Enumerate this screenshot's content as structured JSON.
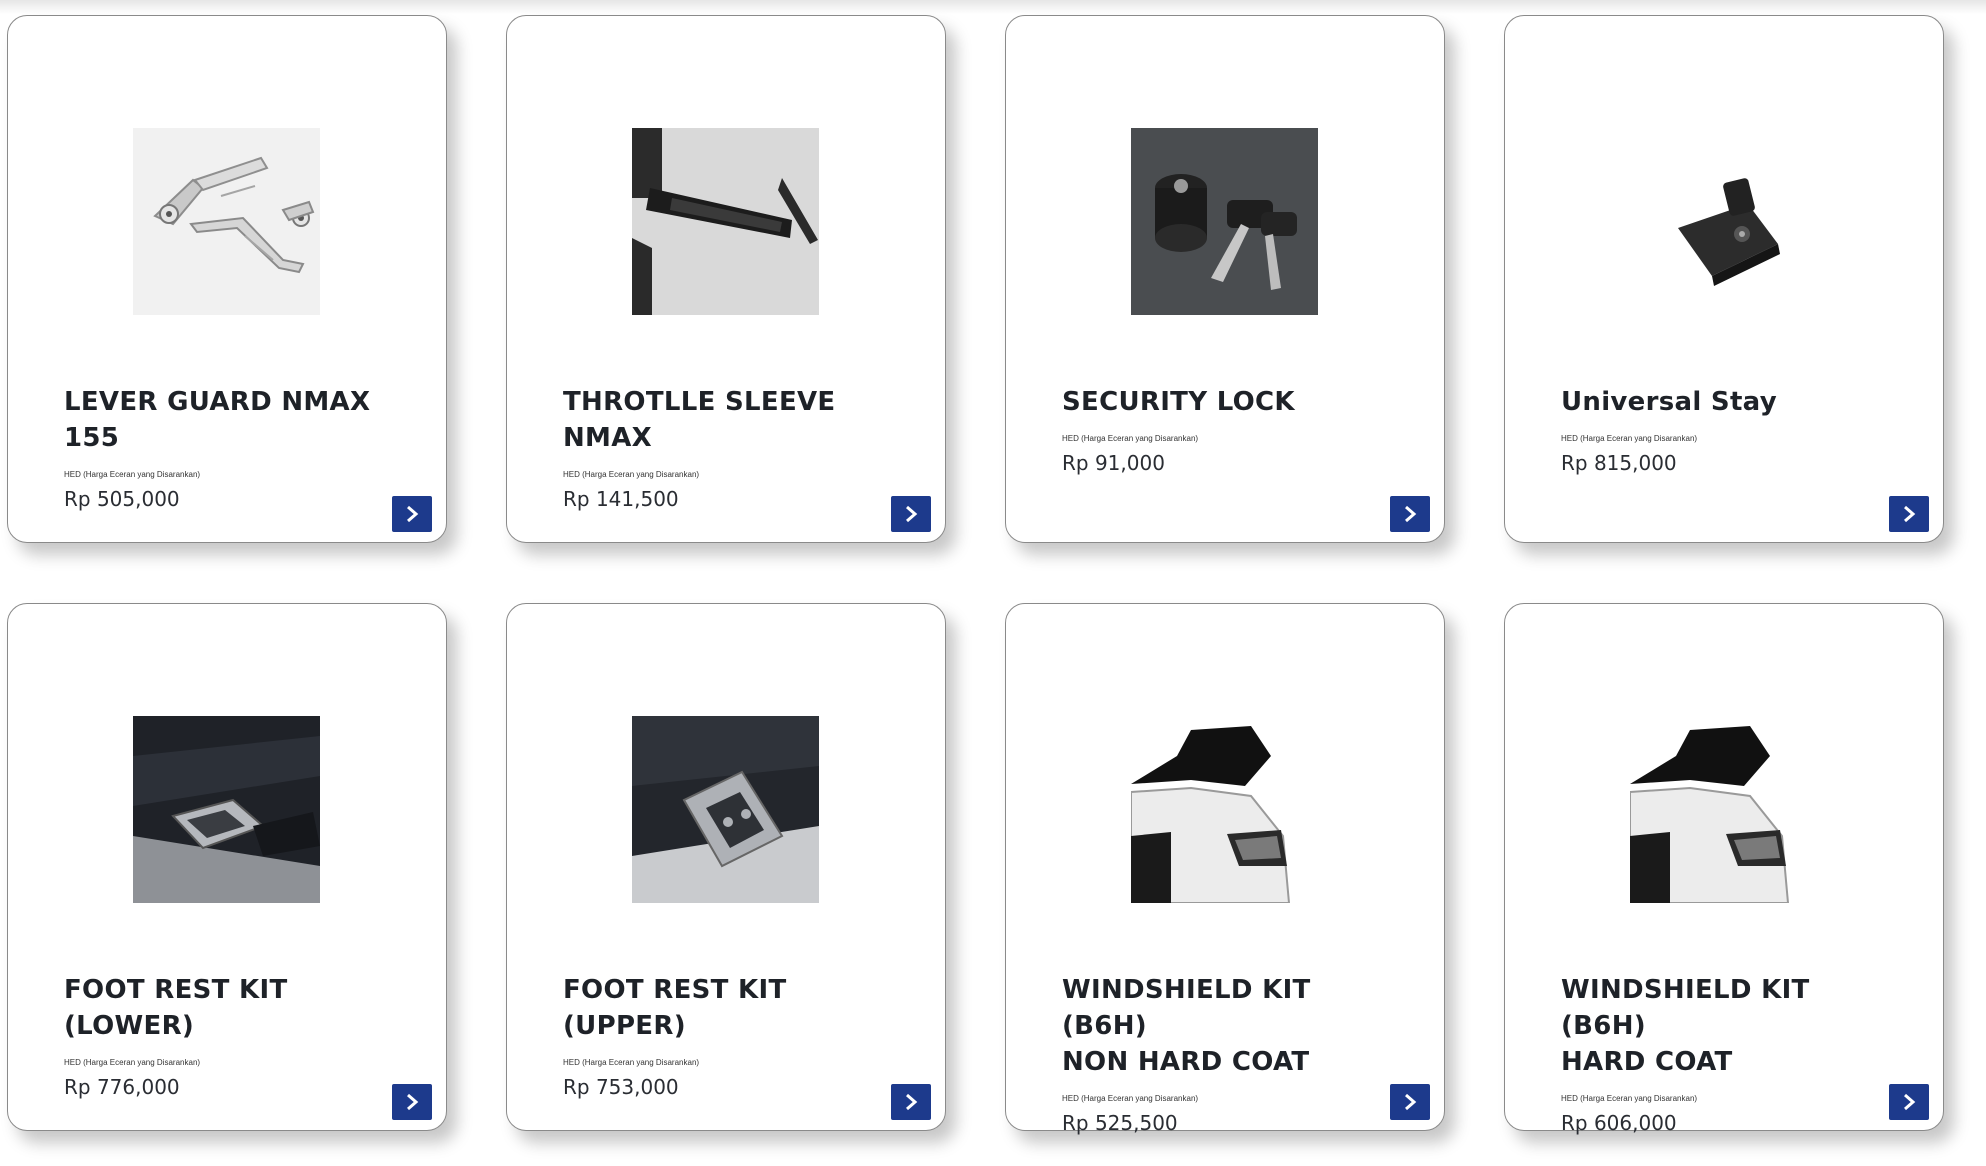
{
  "products": [
    {
      "name_line1": "LEVER GUARD NMAX",
      "name_line2": "155",
      "hed_label": "HED (Harga Eceran yang Disarankan)",
      "price": "Rp 505,000",
      "image_icon": "lever-guard-photo",
      "button_icon": "chevron-right-icon"
    },
    {
      "name_line1": "THROTLLE SLEEVE",
      "name_line2": "NMAX",
      "hed_label": "HED (Harga Eceran yang Disarankan)",
      "price": "Rp 141,500",
      "image_icon": "throttle-sleeve-photo",
      "button_icon": "chevron-right-icon"
    },
    {
      "name_line1": "SECURITY LOCK",
      "name_line2": "",
      "hed_label": "HED (Harga Eceran yang Disarankan)",
      "price": "Rp 91,000",
      "image_icon": "security-lock-photo",
      "button_icon": "chevron-right-icon"
    },
    {
      "name_line1": "Universal Stay",
      "name_line2": "",
      "hed_label": "HED (Harga Eceran yang Disarankan)",
      "price": "Rp 815,000",
      "image_icon": "universal-stay-photo",
      "button_icon": "chevron-right-icon"
    },
    {
      "name_line1": "FOOT REST KIT",
      "name_line2": "(LOWER)",
      "hed_label": "HED (Harga Eceran yang Disarankan)",
      "price": "Rp 776,000",
      "image_icon": "foot-rest-lower-photo",
      "button_icon": "chevron-right-icon"
    },
    {
      "name_line1": "FOOT REST KIT (UPPER)",
      "name_line2": "",
      "hed_label": "HED (Harga Eceran yang Disarankan)",
      "price": "Rp 753,000",
      "image_icon": "foot-rest-upper-photo",
      "button_icon": "chevron-right-icon"
    },
    {
      "name_line1": "WINDSHIELD KIT (B6H)",
      "name_line2": "NON HARD COAT",
      "hed_label": "HED (Harga Eceran yang Disarankan)",
      "price": "Rp 525,500",
      "image_icon": "windshield-photo",
      "button_icon": "chevron-right-icon"
    },
    {
      "name_line1": "WINDSHIELD KIT (B6H)",
      "name_line2": "HARD COAT",
      "hed_label": "HED (Harga Eceran yang Disarankan)",
      "price": "Rp 606,000",
      "image_icon": "windshield-photo",
      "button_icon": "chevron-right-icon"
    }
  ],
  "colors": {
    "button_bg": "#1d3a8c",
    "card_border": "#8a8a8a",
    "text": "#1e2228"
  }
}
